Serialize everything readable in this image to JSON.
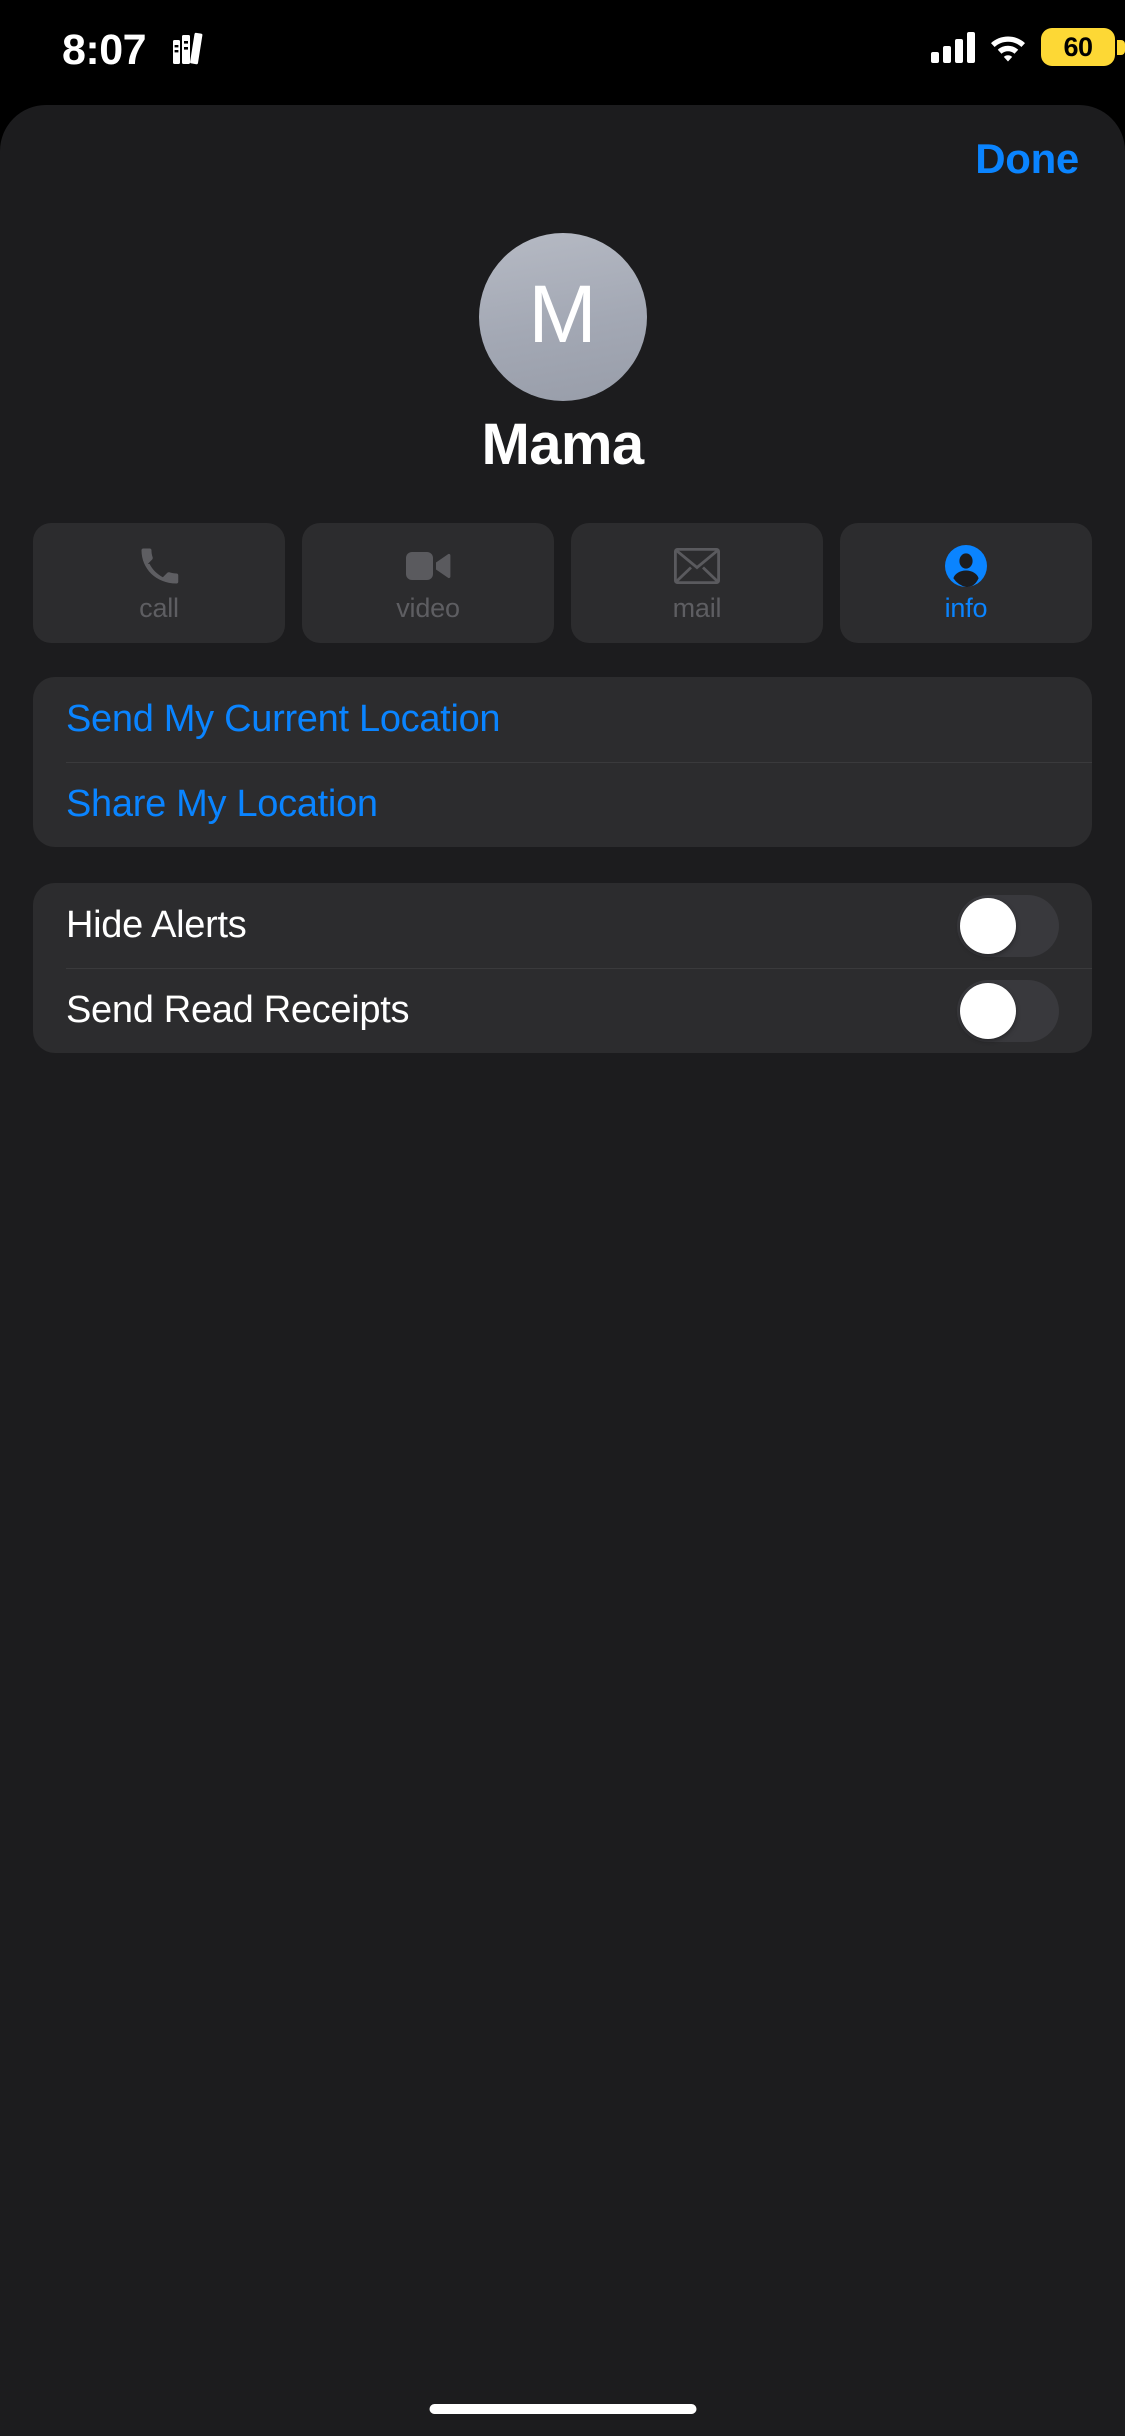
{
  "status_bar": {
    "time": "8:07",
    "books_icon": "books-icon",
    "signal_icon": "cellular-signal-icon",
    "wifi_icon": "wifi-icon",
    "battery_level": "60",
    "battery_color": "#FDD835",
    "battery_low_power_mode": true
  },
  "sheet": {
    "done_label": "Done"
  },
  "contact": {
    "monogram": "M",
    "name": "Mama",
    "avatar_icon": "contact-avatar-monogram"
  },
  "actions": [
    {
      "label": "call",
      "icon": "phone-icon",
      "enabled": false
    },
    {
      "label": "video",
      "icon": "video-camera-icon",
      "enabled": false
    },
    {
      "label": "mail",
      "icon": "envelope-icon",
      "enabled": false
    },
    {
      "label": "info",
      "icon": "person-circle-icon",
      "enabled": true
    }
  ],
  "location_group": [
    {
      "label": "Send My Current Location"
    },
    {
      "label": "Share My Location"
    }
  ],
  "toggle_group": [
    {
      "label": "Hide Alerts",
      "on": false
    },
    {
      "label": "Send Read Receipts",
      "on": false
    }
  ],
  "colors": {
    "accent_blue": "#0A84FF",
    "sheet_background": "#1C1C1E",
    "card_background": "#2C2C2E",
    "separator": "#3A3A3C",
    "disabled_text": "#5E5E62",
    "switch_off_track": "#39393D",
    "switch_knob": "#FFFFFF"
  }
}
